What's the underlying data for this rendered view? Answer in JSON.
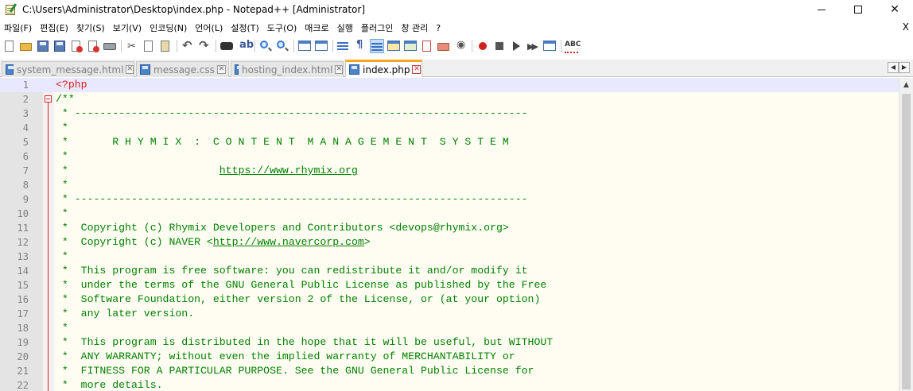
{
  "window": {
    "title": "C:\\Users\\Administrator\\Desktop\\index.php - Notepad++ [Administrator]"
  },
  "menu": [
    "파일(F)",
    "편집(E)",
    "찾기(S)",
    "보기(V)",
    "인코딩(N)",
    "언어(L)",
    "설정(T)",
    "도구(O)",
    "매크로",
    "실행",
    "플러그인",
    "창 관리",
    "?"
  ],
  "menu_close": "X",
  "toolbar": {
    "icons": [
      "new-file-icon",
      "open-file-icon",
      "save-icon",
      "save-all-icon",
      "close-icon",
      "close-all-icon",
      "print-icon",
      "cut-icon",
      "copy-icon",
      "paste-icon",
      "undo-icon",
      "redo-icon",
      "find-icon",
      "replace-icon",
      "zoom-in-icon",
      "zoom-out-icon",
      "sync-vertical-icon",
      "sync-horizontal-icon",
      "word-wrap-icon",
      "show-all-chars-icon",
      "indent-guide-icon",
      "user-lang-icon",
      "doc-map-icon",
      "function-list-icon",
      "folder-workspace-icon",
      "monitoring-icon",
      "record-macro-icon",
      "stop-macro-icon",
      "play-macro-icon",
      "run-macro-multiple-icon",
      "save-macro-icon",
      "spell-check-icon"
    ],
    "spell_label": "ABC"
  },
  "tabs": [
    {
      "label": "system_message.html",
      "active": false
    },
    {
      "label": "message.css",
      "active": false
    },
    {
      "label": "hosting_index.html",
      "active": false
    },
    {
      "label": "index.php",
      "active": true
    }
  ],
  "tab_close_glyph": "✕",
  "editor": {
    "current_line": 1,
    "lines": [
      {
        "n": "1",
        "text": "<?php"
      },
      {
        "n": "2",
        "text": "/**"
      },
      {
        "n": "3",
        "text": " * ------------------------------------------------------------------------"
      },
      {
        "n": "4",
        "text": " *"
      },
      {
        "n": "5",
        "text": " *       R H Y M I X  :  C O N T E N T  M A N A G E M E N T  S Y S T E M"
      },
      {
        "n": "6",
        "text": " *"
      },
      {
        "n": "7",
        "text": " *                        ",
        "link": "https://www.rhymix.org"
      },
      {
        "n": "8",
        "text": " *"
      },
      {
        "n": "9",
        "text": " * ------------------------------------------------------------------------"
      },
      {
        "n": "10",
        "text": " *"
      },
      {
        "n": "11",
        "text": " *  Copyright (c) Rhymix Developers and Contributors <devops@rhymix.org>"
      },
      {
        "n": "12",
        "text": " *  Copyright (c) NAVER <",
        "link": "http://www.navercorp.com",
        "tail": ">"
      },
      {
        "n": "13",
        "text": " *"
      },
      {
        "n": "14",
        "text": " *  This program is free software: you can redistribute it and/or modify it"
      },
      {
        "n": "15",
        "text": " *  under the terms of the GNU General Public License as published by the Free"
      },
      {
        "n": "16",
        "text": " *  Software Foundation, either version 2 of the License, or (at your option)"
      },
      {
        "n": "17",
        "text": " *  any later version."
      },
      {
        "n": "18",
        "text": " *"
      },
      {
        "n": "19",
        "text": " *  This program is distributed in the hope that it will be useful, but WITHOUT"
      },
      {
        "n": "20",
        "text": " *  ANY WARRANTY; without even the implied warranty of MERCHANTABILITY or"
      },
      {
        "n": "21",
        "text": " *  FITNESS FOR A PARTICULAR PURPOSE. See the GNU General Public License for"
      },
      {
        "n": "22",
        "text": " *  more details."
      }
    ]
  },
  "colors": {
    "php_tag": "#e02020",
    "comment": "#008000",
    "editor_bg": "#fffcf2",
    "current_line_bg": "#e8e8ff",
    "active_tab_accent": "#f6a821"
  }
}
